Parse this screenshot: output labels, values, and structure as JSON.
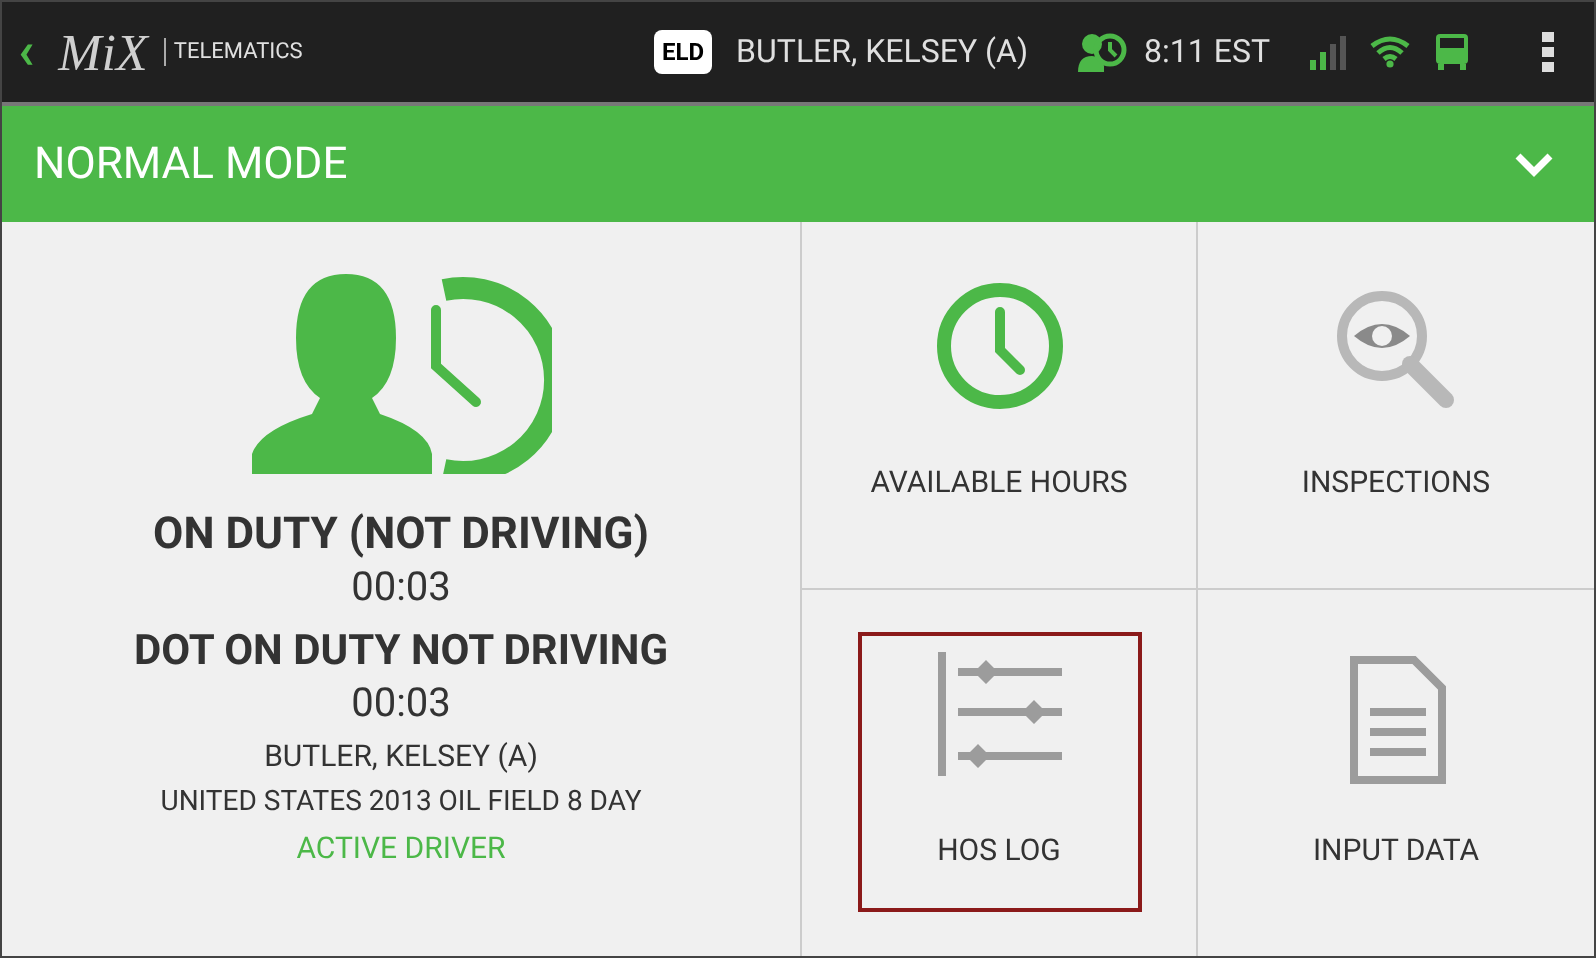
{
  "top_bar": {
    "back": "‹",
    "logo": "MiX",
    "brand": "TELEMATICS",
    "eld_badge": "ELD",
    "driver": "BUTLER, KELSEY (A)",
    "time": "8:11 EST"
  },
  "mode_banner": {
    "title": "NORMAL MODE",
    "expanded": false
  },
  "status_panel": {
    "status": "ON DUTY (NOT DRIVING)",
    "status_time": "00:03",
    "dot_status": "DOT ON DUTY NOT DRIVING",
    "dot_time": "00:03",
    "driver": "BUTLER, KELSEY (A)",
    "ruleset": "UNITED STATES 2013 OIL FIELD 8 DAY",
    "role": "ACTIVE DRIVER"
  },
  "tiles": [
    {
      "kind": "hours",
      "label": "AVAILABLE HOURS",
      "selected": false
    },
    {
      "kind": "inspections",
      "label": "INSPECTIONS",
      "selected": false
    },
    {
      "kind": "log",
      "label": "HOS LOG",
      "selected": true
    },
    {
      "kind": "input",
      "label": "INPUT DATA",
      "selected": false
    }
  ]
}
